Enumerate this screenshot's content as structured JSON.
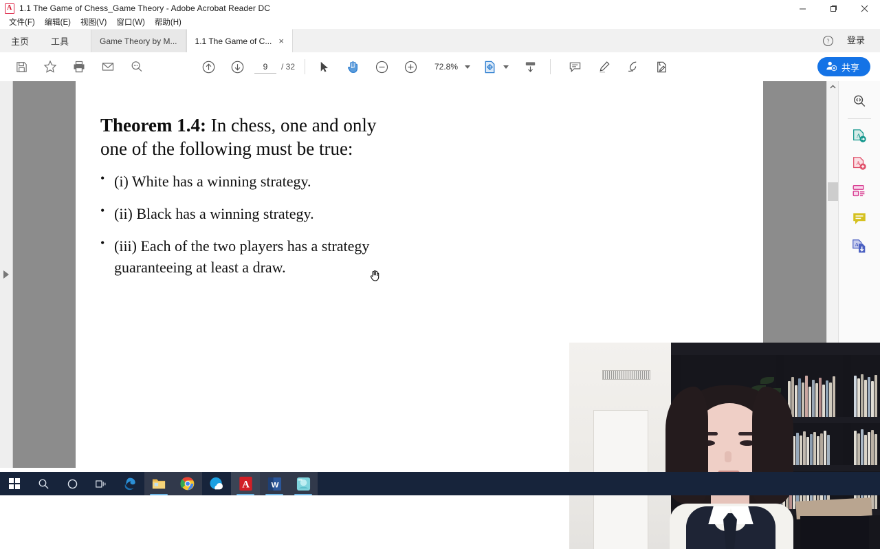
{
  "window": {
    "title": "1.1 The Game of Chess_Game Theory - Adobe Acrobat Reader DC",
    "app_icon": "pdf-icon",
    "minimize_label": "—",
    "maximize_label": "❐",
    "close_label": "✕"
  },
  "menubar": {
    "items": [
      {
        "label": "文件(F)",
        "name": "menu-file"
      },
      {
        "label": "编辑(E)",
        "name": "menu-edit"
      },
      {
        "label": "视图(V)",
        "name": "menu-view"
      },
      {
        "label": "窗口(W)",
        "name": "menu-window"
      },
      {
        "label": "帮助(H)",
        "name": "menu-help"
      }
    ]
  },
  "tabstrip": {
    "home_label": "主页",
    "tools_label": "工具",
    "tabs": [
      {
        "label": "Game Theory by M...",
        "active": false,
        "closable": false
      },
      {
        "label": "1.1 The Game of C...",
        "active": true,
        "closable": true,
        "close_glyph": "×"
      }
    ],
    "help_icon": "question-circle-icon",
    "signin_label": "登录"
  },
  "toolbar": {
    "buttons_left": [
      {
        "name": "save-file-icon",
        "tooltip": "Save"
      },
      {
        "name": "star-icon",
        "tooltip": "Add to favorites"
      },
      {
        "name": "print-icon",
        "tooltip": "Print"
      },
      {
        "name": "email-icon",
        "tooltip": "Email"
      },
      {
        "name": "search-icon",
        "tooltip": "Find"
      }
    ],
    "prev_page_icon": "arrow-up-circle-icon",
    "next_page_icon": "arrow-down-circle-icon",
    "page_current": "9",
    "page_total": "/ 32",
    "select_tool_icon": "cursor-arrow-icon",
    "hand_tool_icon": "hand-icon",
    "zoom_out_icon": "minus-circle-icon",
    "zoom_in_icon": "plus-circle-icon",
    "zoom_value": "72.8%",
    "zoom_dropdown_icon": "chevron-down-icon",
    "fit_page_icon": "fit-page-icon",
    "fit_dropdown_icon": "chevron-down-icon",
    "scroll_mode_icon": "page-scroll-icon",
    "comment_icon": "comment-icon",
    "highlight_icon": "highlighter-icon",
    "draw_icon": "pen-draw-icon",
    "sign_icon": "sign-document-icon",
    "share_label": "共享",
    "share_icon": "add-person-icon",
    "share_color": "#1473e6"
  },
  "document": {
    "theorem_label": "Theorem 1.4:",
    "theorem_text": " In chess, one and only one of the following must be true:",
    "bullets": [
      "(i) White has a winning strategy.",
      "(ii) Black has a winning strategy.",
      "(iii) Each of the two players has a strategy guaranteeing at least a draw."
    ],
    "cursor_icon": "hand-cursor-icon",
    "page_background": "#ffffff",
    "viewer_background": "#8c8c8c"
  },
  "left_panel": {
    "expand_icon": "triangle-right-icon"
  },
  "right_rail": {
    "items": [
      {
        "name": "search-document-icon",
        "color": "#4a4a4a"
      },
      {
        "name": "export-pdf-icon",
        "color": "#16988e"
      },
      {
        "name": "create-pdf-icon",
        "color": "#e0516b"
      },
      {
        "name": "edit-pdf-icon",
        "color": "#d6368c"
      },
      {
        "name": "comment-tool-icon",
        "color": "#d5c11f"
      },
      {
        "name": "combine-files-icon",
        "color": "#4a5fc1"
      }
    ]
  },
  "scrollbar": {
    "up_arrow": "▲",
    "down_arrow": "▼"
  },
  "webcam": {
    "label": "webcam-overlay"
  },
  "taskbar": {
    "background": "#17243b",
    "items": [
      {
        "name": "start-button",
        "icon": "windows-logo-icon",
        "active": false
      },
      {
        "name": "search-taskbar",
        "icon": "search-icon",
        "active": false
      },
      {
        "name": "cortana-button",
        "icon": "circle-icon",
        "active": false
      },
      {
        "name": "task-view-button",
        "icon": "task-view-icon",
        "active": false
      },
      {
        "name": "edge-taskbar-icon",
        "icon": "edge-icon",
        "active": false
      },
      {
        "name": "file-explorer-taskbar-icon",
        "icon": "folder-icon",
        "active": true
      },
      {
        "name": "chrome-taskbar-icon",
        "icon": "chrome-icon",
        "active": true
      },
      {
        "name": "qq-browser-taskbar-icon",
        "icon": "qq-browser-icon",
        "active": false
      },
      {
        "name": "acrobat-taskbar-icon",
        "icon": "acrobat-icon",
        "active": true
      },
      {
        "name": "word-taskbar-icon",
        "icon": "word-icon",
        "active": true,
        "letter": "W"
      },
      {
        "name": "camtasia-taskbar-icon",
        "icon": "camtasia-icon",
        "active": true
      }
    ]
  }
}
